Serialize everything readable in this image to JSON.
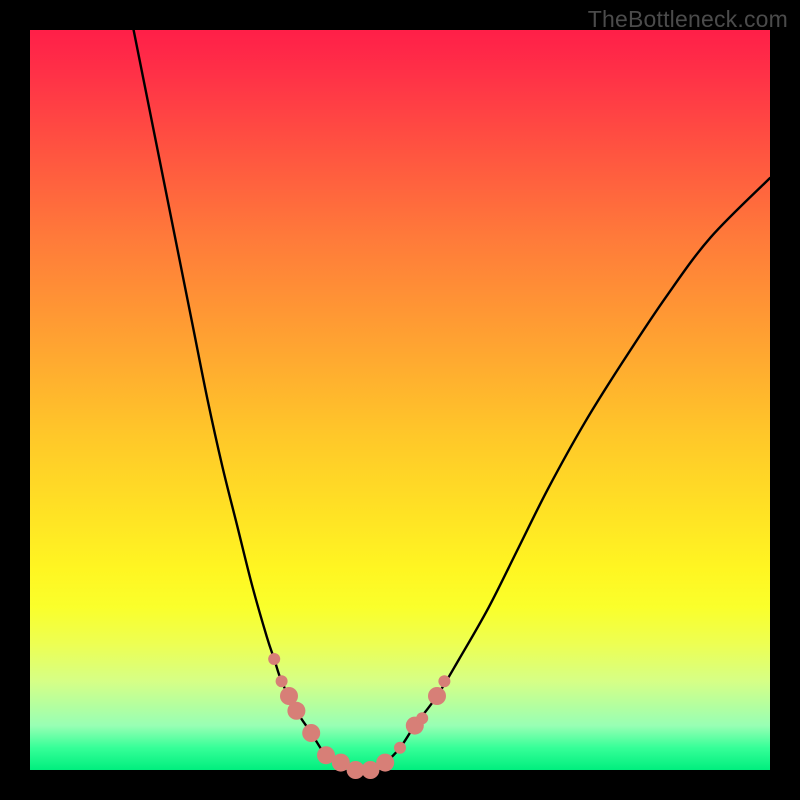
{
  "watermark": "TheBottleneck.com",
  "chart_data": {
    "type": "line",
    "title": "",
    "xlabel": "",
    "ylabel": "",
    "xlim": [
      0,
      100
    ],
    "ylim": [
      0,
      100
    ],
    "grid": false,
    "gradient_colors": {
      "top": "#ff1f48",
      "mid": "#fff622",
      "bottom": "#00ee7e"
    },
    "series": [
      {
        "name": "bottleneck-curve",
        "color": "#000000",
        "x": [
          14,
          16,
          18,
          20,
          22,
          24,
          26,
          28,
          30,
          32,
          33,
          34,
          36,
          38,
          40,
          42,
          44,
          45,
          46,
          48,
          50,
          52,
          55,
          58,
          62,
          66,
          70,
          75,
          80,
          86,
          92,
          100
        ],
        "y": [
          100,
          90,
          80,
          70,
          60,
          50,
          41,
          33,
          25,
          18,
          15,
          12,
          8,
          5,
          2,
          1,
          0,
          0,
          0,
          1,
          3,
          6,
          10,
          15,
          22,
          30,
          38,
          47,
          55,
          64,
          72,
          80
        ]
      }
    ],
    "markers": {
      "name": "highlight-dots",
      "color": "#d77f77",
      "radius_small": 6,
      "radius_large": 9,
      "points": [
        {
          "x": 33,
          "y": 15,
          "r": "small"
        },
        {
          "x": 34,
          "y": 12,
          "r": "small"
        },
        {
          "x": 35,
          "y": 10,
          "r": "large"
        },
        {
          "x": 36,
          "y": 8,
          "r": "large"
        },
        {
          "x": 38,
          "y": 5,
          "r": "large"
        },
        {
          "x": 40,
          "y": 2,
          "r": "large"
        },
        {
          "x": 42,
          "y": 1,
          "r": "large"
        },
        {
          "x": 44,
          "y": 0,
          "r": "large"
        },
        {
          "x": 46,
          "y": 0,
          "r": "large"
        },
        {
          "x": 48,
          "y": 1,
          "r": "large"
        },
        {
          "x": 50,
          "y": 3,
          "r": "small"
        },
        {
          "x": 52,
          "y": 6,
          "r": "large"
        },
        {
          "x": 53,
          "y": 7,
          "r": "small"
        },
        {
          "x": 55,
          "y": 10,
          "r": "large"
        },
        {
          "x": 56,
          "y": 12,
          "r": "small"
        }
      ]
    }
  }
}
